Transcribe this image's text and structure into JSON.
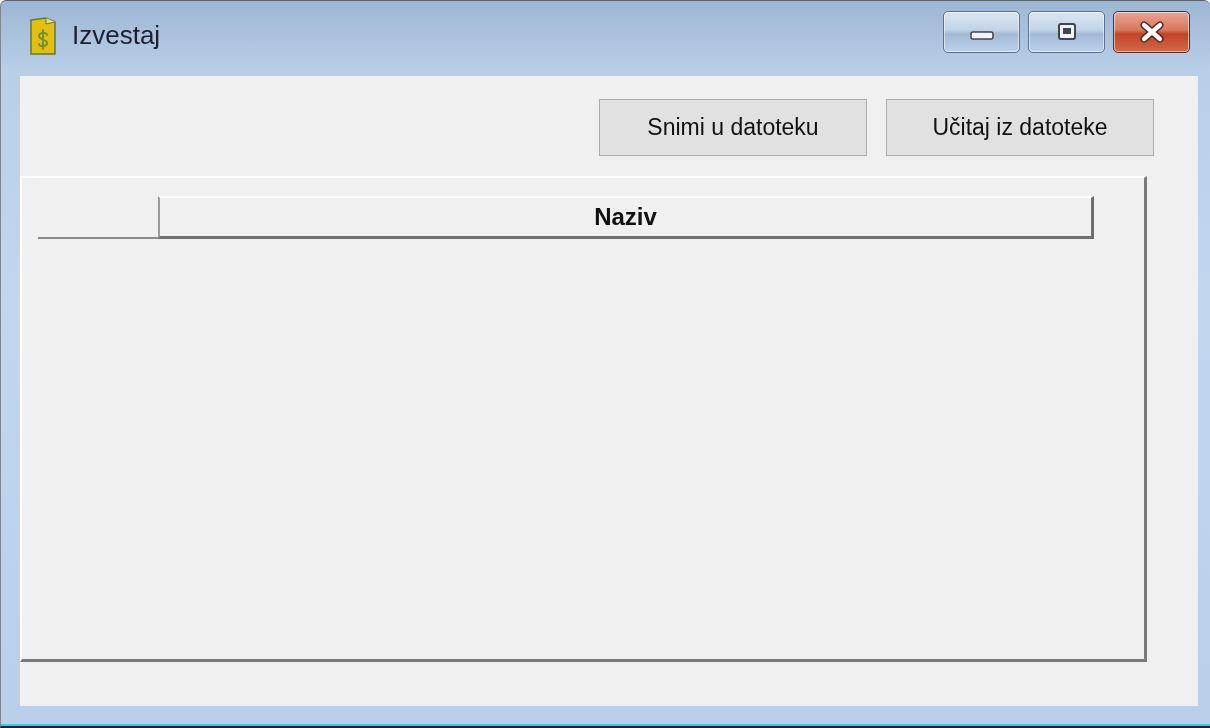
{
  "window": {
    "title": "Izvestaj"
  },
  "toolbar": {
    "buttons": [
      "Snimi u datoteku",
      "Učitaj iz datoteke"
    ]
  },
  "table": {
    "columns": [
      "Naziv"
    ]
  }
}
